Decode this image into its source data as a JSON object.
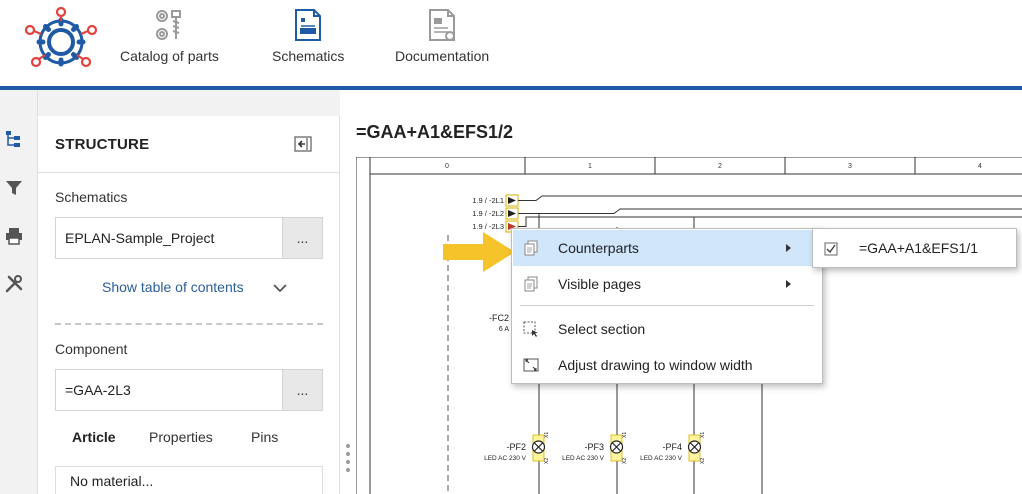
{
  "nav": {
    "catalog_label": "Catalog of parts",
    "schematics_label": "Schematics",
    "documentation_label": "Documentation"
  },
  "structure": {
    "title": "STRUCTURE",
    "schematics_label": "Schematics",
    "schematics_value": "EPLAN-Sample_Project",
    "browse_label": "...",
    "toc_label": "Show table of contents",
    "component_label": "Component",
    "component_value": "=GAA-2L3",
    "tabs": [
      "Article",
      "Properties",
      "Pins"
    ],
    "active_tab": "Article",
    "material_row": "No material..."
  },
  "page": {
    "title": "=GAA+A1&EFS1/2"
  },
  "drawing": {
    "columns": [
      "0",
      "1",
      "2",
      "3",
      "4"
    ],
    "conn_labels": [
      "1.9 / -2L1",
      "1.9 / -2L2",
      "1.9 / -2L3"
    ],
    "fc_label": "-FC2",
    "fc_sub": "6 A",
    "lamps": [
      {
        "name": "-PF2",
        "sub": "LED AC 230 V"
      },
      {
        "name": "-PF3",
        "sub": "LED AC 230 V"
      },
      {
        "name": "-PF4",
        "sub": "LED AC 230 V"
      }
    ],
    "pin_top": "X1",
    "pin_bottom": "X2"
  },
  "context_menu": {
    "items": [
      {
        "label": "Counterparts",
        "icon": "pages-icon",
        "submenu": true
      },
      {
        "label": "Visible pages",
        "icon": "pages-icon",
        "submenu": true
      },
      {
        "label": "Select section",
        "icon": "select-section-icon",
        "submenu": false
      },
      {
        "label": "Adjust drawing to window width",
        "icon": "fit-width-icon",
        "submenu": false
      }
    ],
    "submenu_item": "=GAA+A1&EFS1/1"
  },
  "colors": {
    "brand_blue": "#1f5aa6",
    "logo_red": "#e2423f",
    "highlight": "#cfe6fb",
    "arrow_yellow": "#f5c32a",
    "link_blue": "#2a5d9c"
  }
}
